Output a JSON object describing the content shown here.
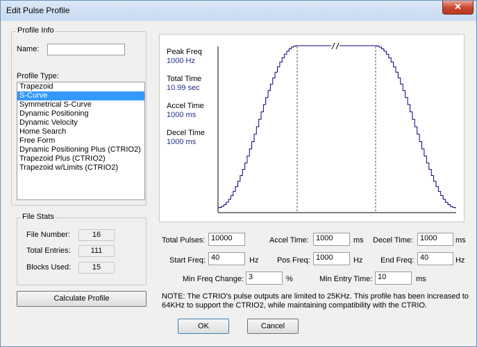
{
  "window": {
    "title": "Edit Pulse Profile",
    "close_glyph": "✕"
  },
  "profile_info": {
    "group_label": "Profile Info",
    "name_label": "Name:",
    "name_value": "",
    "type_label": "Profile Type:",
    "types": [
      "Trapezoid",
      "S-Curve",
      "Symmetrical S-Curve",
      "Dynamic Positioning",
      "Dynamic Velocity",
      "Home Search",
      "Free Form",
      "Dynamic Positioning Plus (CTRIO2)",
      "Trapezoid Plus (CTRIO2)",
      "Trapezoid w/Limits (CTRIO2)"
    ],
    "selected_index": 1
  },
  "file_stats": {
    "group_label": "File Stats",
    "file_number_label": "File Number:",
    "file_number": "16",
    "total_entries_label": "Total Entries:",
    "total_entries": "111",
    "blocks_used_label": "Blocks Used:",
    "blocks_used": "15"
  },
  "calculate_button": "Calculate Profile",
  "plot": {
    "peak_freq_label": "Peak Freq",
    "peak_freq": "1000 Hz",
    "total_time_label": "Total Time",
    "total_time": "10.99 sec",
    "accel_time_label": "Accel Time",
    "accel_time": "1000 ms",
    "decel_time_label": "Decel Time",
    "decel_time": "1000 ms",
    "line_color": "#000080",
    "steps_per_ramp": 34
  },
  "params": {
    "total_pulses_label": "Total Pulses:",
    "total_pulses": "10000",
    "accel_time_label": "Accel Time:",
    "accel_time": "1000",
    "accel_unit": "ms",
    "decel_time_label": "Decel Time:",
    "decel_time": "1000",
    "decel_unit": "ms",
    "start_freq_label": "Start Freq:",
    "start_freq": "40",
    "start_unit": "Hz",
    "pos_freq_label": "Pos Freq:",
    "pos_freq": "1000",
    "pos_unit": "Hz",
    "end_freq_label": "End Freq:",
    "end_freq": "40",
    "end_unit": "Hz",
    "min_freq_change_label": "Min Freq Change:",
    "min_freq_change": "3",
    "min_freq_unit": "%",
    "min_entry_time_label": "Min Entry Time:",
    "min_entry_time": "10",
    "min_entry_unit": "ms"
  },
  "note_line1": "NOTE: The CTRIO's pulse outputs are limited to 25KHz. This profile has been increased to",
  "note_line2": "64KHz to support the CTRIO2, while maintaining compatibility with the CTRIO.",
  "buttons": {
    "ok": "OK",
    "cancel": "Cancel"
  }
}
